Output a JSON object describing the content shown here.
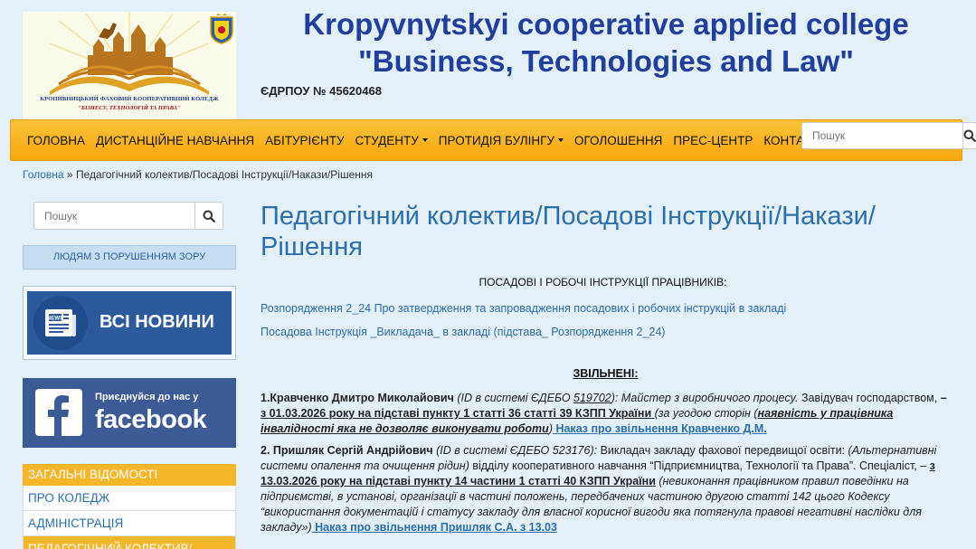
{
  "header": {
    "logo_text_line1": "КРОПИВНИЦЬКИЙ ФАХОВИЙ КООПЕРАТИВНИЙ КОЛЕДЖ",
    "logo_text_line2": "\"БІЗНЕСУ, ТЕХНОЛОГІЙ ТА ПРАВА\"",
    "title_line1": "Kropyvnytskyi cooperative applied college",
    "title_line2": "\"Business, Technologies and Law\"",
    "edrpou": "ЄДРПОУ № 45620468"
  },
  "nav": {
    "items": [
      {
        "label": "ГОЛОВНА",
        "dropdown": false
      },
      {
        "label": "ДИСТАНЦІЙНЕ НАВЧАННЯ",
        "dropdown": false
      },
      {
        "label": "АБІТУРІЄНТУ",
        "dropdown": false
      },
      {
        "label": "СТУДЕНТУ",
        "dropdown": true
      },
      {
        "label": "ПРОТИДІЯ БУЛІНГУ",
        "dropdown": true
      },
      {
        "label": "ОГОЛОШЕННЯ",
        "dropdown": false
      },
      {
        "label": "ПРЕС-ЦЕНТР",
        "dropdown": false
      },
      {
        "label": "КОНТАКТИ",
        "dropdown": false
      }
    ],
    "search_placeholder": "Пошук"
  },
  "breadcrumb": {
    "home": "Головна",
    "separator": " » ",
    "current": "Педагогічний колектив/Посадові Інструкції/Накази/Рішення"
  },
  "sidebar": {
    "search_placeholder": "Пошук",
    "vision_button": "ЛЮДЯМ З ПОРУШЕННЯМ ЗОРУ",
    "news_banner": "ВСІ НОВИНИ",
    "news_icon_label": "NEWS",
    "facebook_join": "Приєднуйся до нас у",
    "facebook_word": "facebook",
    "menu_heading": "ЗАГАЛЬНІ ВІДОМОСТІ",
    "menu_items": [
      "ПРО КОЛЕДЖ",
      "АДМІНІСТРАЦІЯ",
      "ПЕДАГОГІЧНИЙ КОЛЕКТИВ/"
    ]
  },
  "main": {
    "title_line1": "Педагогічний колектив/Посадові Інструкції/Накази/",
    "title_line2": "Рішення",
    "subheading": "ПОСАДОВІ І РОБОЧІ ІНСТРУКЦІЇ ПРАЦІВНИКІВ:",
    "links": [
      "Розпорядження 2_24 Про затвердження та запровадження посадових і робочих інструкцій в закладі",
      "Посадова Інструкція _Викладача_ в закладі (підстава_ Розпорядження 2_24)"
    ],
    "fired_heading": "ЗВІЛЬНЕНІ:",
    "entry1": {
      "name": "1.Кравченко Дмитро Миколайович",
      "id_prefix": " (ID в системі ЄДЕБО ",
      "id_num": "519702",
      "id_suffix": "): Майстер з виробничого процесу.",
      "plain": " Завідувач господарством, ",
      "dash": "–",
      "date_basis": " з 01.03.2026 року на підставі пункту 1 статті 36 статті 39 КЗПП України ",
      "reason_open": " (за угодою сторін (",
      "reason_bold": "наявність у працівника інвалідності яка не дозволяє виконувати роботи",
      "reason_close": ")",
      "order_link": " Наказ про звільнення Кравченко Д.М."
    },
    "entry2": {
      "name": "2. Пришляк Сергій Андрійович",
      "id_text": " (ID в системі ЄДЕБО 523176):",
      "plain1": " Викладач закладу фахової передвищої освіти:",
      "italic1": " (Альтернативні системи опалення та очищення  рідин)",
      "plain2": " відділу кооперативного навчання “Підприємництва, Технології та Права”. Спеціаліст, – ",
      "date_basis": "з 13.03.2026 року на підставі  пункту 14 частини 1 статті 40 КЗПП України",
      "reason": " (невиконання працівником правил поведінки на підприємстві, в установі, організації в частині положень, передбачених частиною другою статті 142 цього Кодексу “використання документацій і статусу закладу для власної корисної вигоди яка потягнула правові негативні наслідки для закладу»)",
      "order_link": " Наказ про звільнення Пришляк С.А. з 13.03"
    }
  },
  "colors": {
    "background": "#e3eff9",
    "nav_orange": "#f5a70e",
    "title_blue": "#1f3f9e",
    "link_blue": "#2a6fb0",
    "facebook_blue": "#3b5b97"
  },
  "icons": [
    "search-icon",
    "dropdown-caret-icon",
    "news-icon",
    "facebook-f-icon",
    "college-logo",
    "city-emblem"
  ]
}
